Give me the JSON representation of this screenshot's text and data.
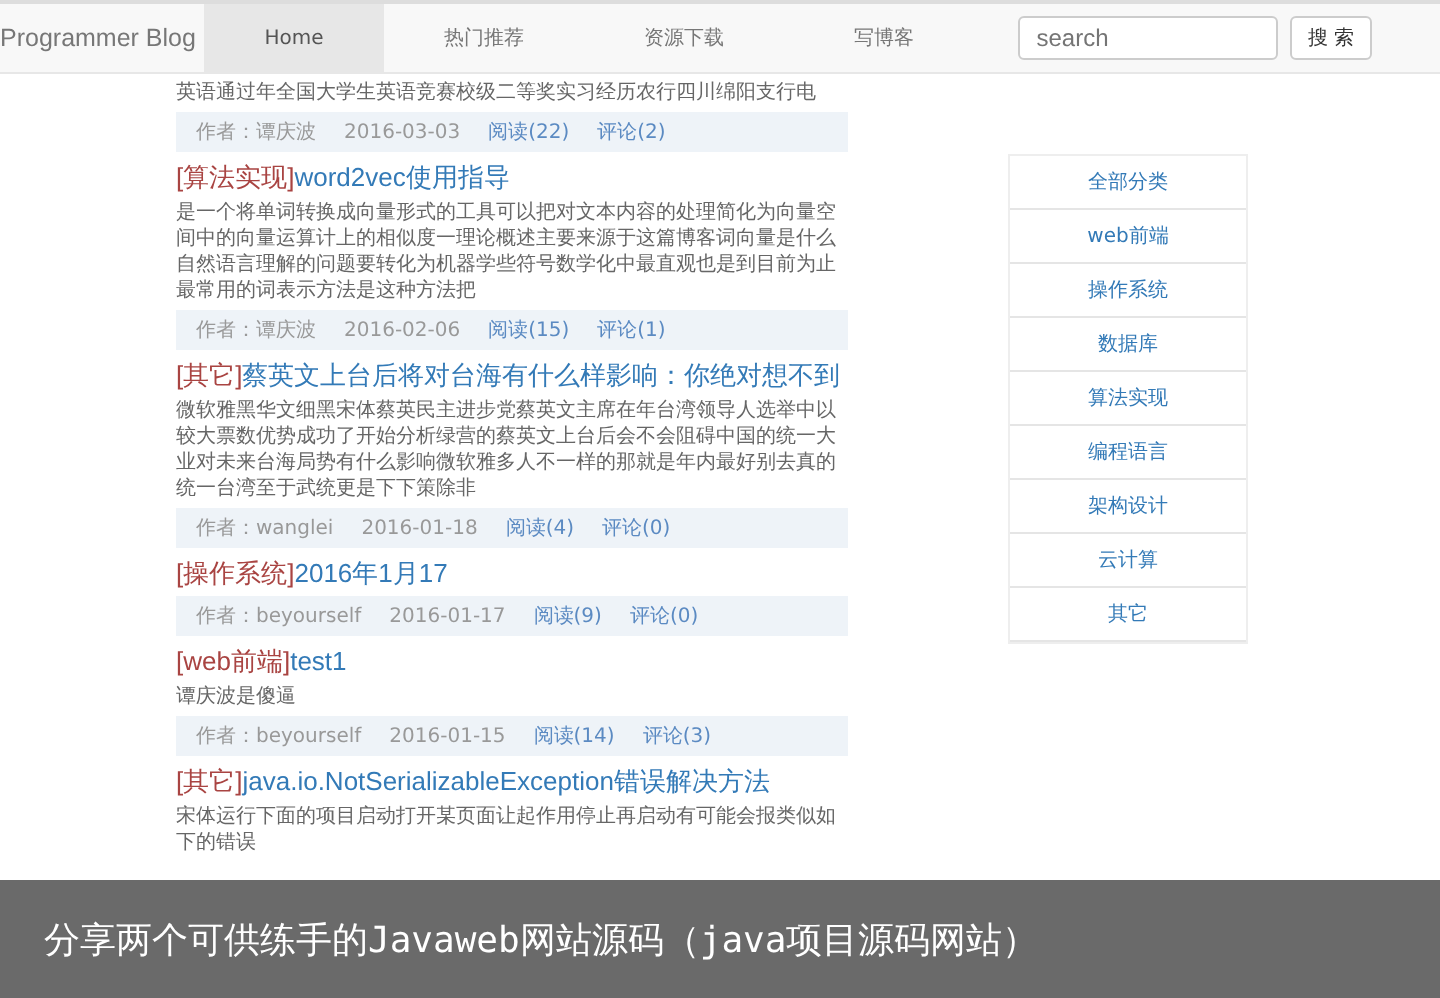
{
  "navbar": {
    "brand": "Programmer Blog",
    "items": [
      {
        "label": "Home",
        "selected": true
      },
      {
        "label": "热门推荐",
        "selected": false
      },
      {
        "label": "资源下载",
        "selected": false
      },
      {
        "label": "写博客",
        "selected": false
      }
    ],
    "search": {
      "placeholder": "search"
    },
    "search_button": "搜 索"
  },
  "posts": [
    {
      "summary": "英语通过年全国大学生英语竞赛校级二等奖实习经历农行四川绵阳支行电",
      "author": "作者：谭庆波",
      "date": "2016-03-03",
      "reads": "阅读(22)",
      "comments": "评论(2)"
    },
    {
      "category": "[算法实现]",
      "title": "word2vec使用指导",
      "summary": "是一个将单词转换成向量形式的工具可以把对文本内容的处理简化为向量空间中的向量运算计上的相似度一理论概述主要来源于这篇博客词向量是什么自然语言理解的问题要转化为机器学些符号数学化中最直观也是到目前为止最常用的词表示方法是这种方法把",
      "author": "作者：谭庆波",
      "date": "2016-02-06",
      "reads": "阅读(15)",
      "comments": "评论(1)"
    },
    {
      "category": "[其它]",
      "title": "蔡英文上台后将对台海有什么样影响：你绝对想不到",
      "summary": "微软雅黑华文细黑宋体蔡英民主进步党蔡英文主席在年台湾领导人选举中以较大票数优势成功了开始分析绿营的蔡英文上台后会不会阻碍中国的统一大业对未来台海局势有什么影响微软雅多人不一样的那就是年内最好别去真的统一台湾至于武统更是下下策除非",
      "author": "作者：wanglei",
      "date": "2016-01-18",
      "reads": "阅读(4)",
      "comments": "评论(0)"
    },
    {
      "category": "[操作系统]",
      "title": "2016年1月17",
      "author": "作者：beyourself",
      "date": "2016-01-17",
      "reads": "阅读(9)",
      "comments": "评论(0)"
    },
    {
      "category": "[web前端]",
      "title": "test1",
      "summary": "谭庆波是傻逼",
      "author": "作者：beyourself",
      "date": "2016-01-15",
      "reads": "阅读(14)",
      "comments": "评论(3)"
    },
    {
      "category": "[其它]",
      "title": "java.io.NotSerializableException错误解决方法",
      "summary": "宋体运行下面的项目启动打开某页面让起作用停止再启动有可能会报类似如下的错误"
    }
  ],
  "sidebar": {
    "categories": [
      "全部分类",
      "web前端",
      "操作系统",
      "数据库",
      "算法实现",
      "编程语言",
      "架构设计",
      "云计算",
      "其它"
    ]
  },
  "caption": "分享两个可供练手的Javaweb网站源码（java项目源码网站）"
}
